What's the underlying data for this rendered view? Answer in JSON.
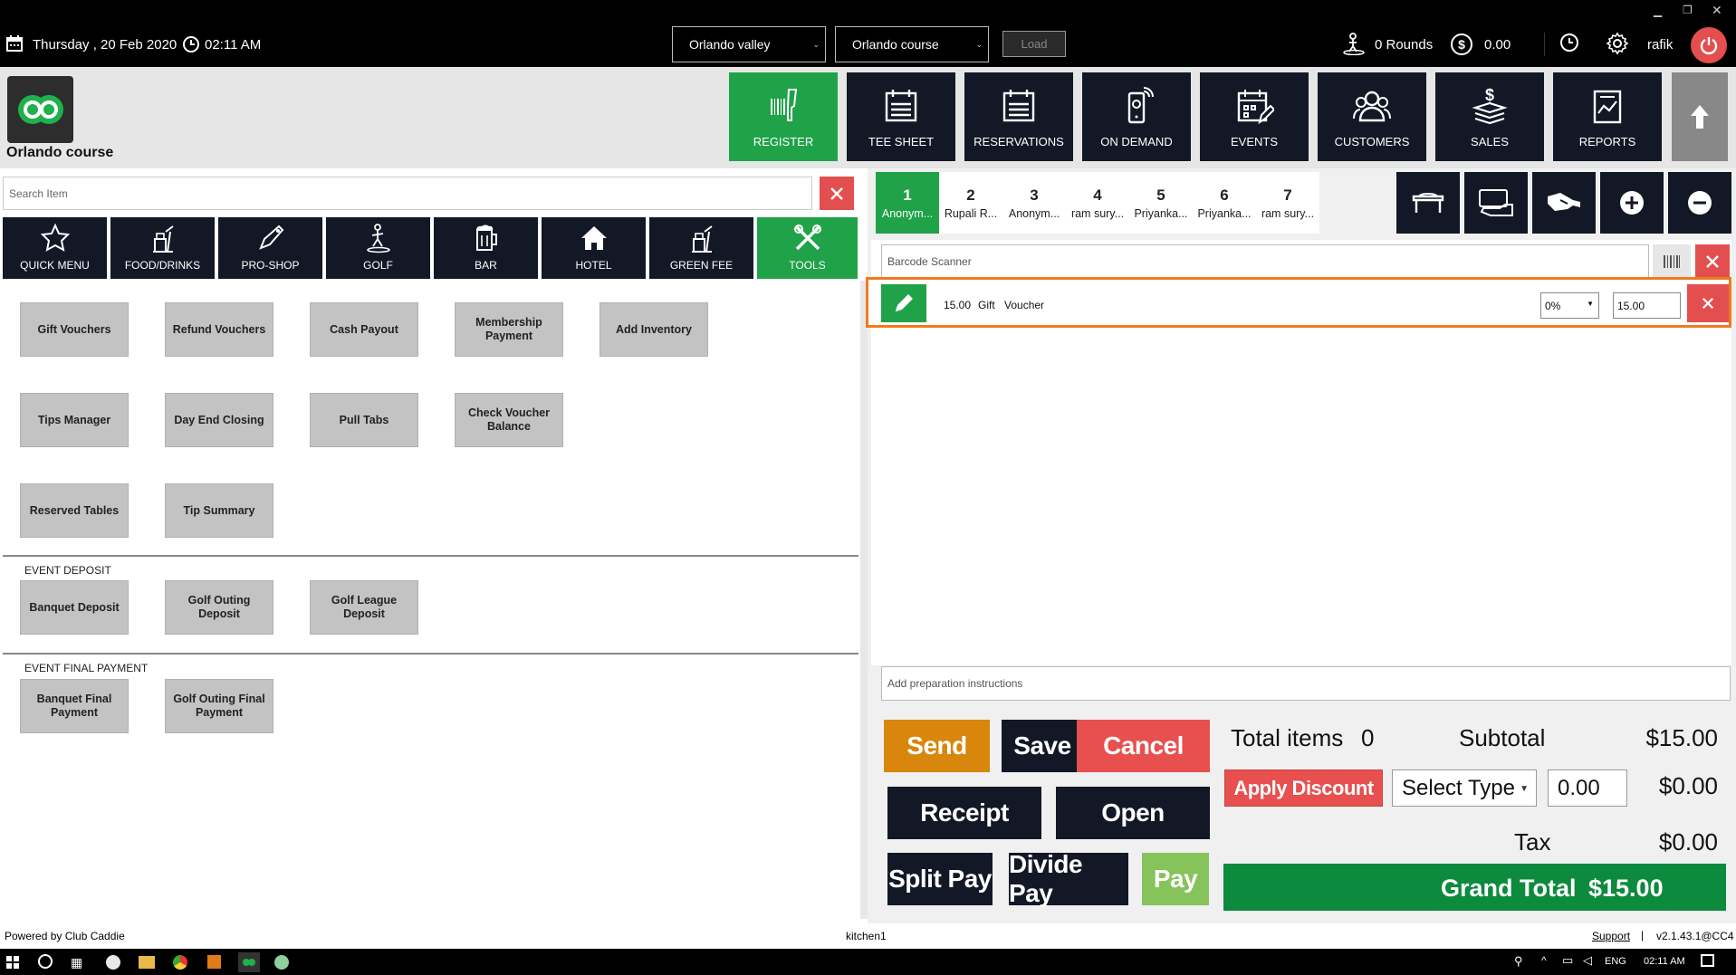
{
  "colors": {
    "accent_green": "#20a249",
    "nav_dark": "#121826",
    "danger_red": "#e34f4f",
    "send_orange": "#d8860c",
    "pay_green": "#86c35a",
    "highlight_orange": "#f07a1e"
  },
  "topbar": {
    "date": "Thursday , 20 Feb 2020",
    "time": "02:11 AM",
    "course_select_1": "Orlando valley",
    "course_select_2": "Orlando course",
    "load_label": "Load",
    "rounds": "0 Rounds",
    "amount": "0.00",
    "user": "rafik"
  },
  "brand": {
    "course_name": "Orlando course"
  },
  "nav": [
    {
      "label": "REGISTER",
      "icon": "barcode-scanner-icon"
    },
    {
      "label": "TEE SHEET",
      "icon": "calendar-list-icon"
    },
    {
      "label": "RESERVATIONS",
      "icon": "calendar-list-icon"
    },
    {
      "label": "ON DEMAND",
      "icon": "mobile-phone-icon"
    },
    {
      "label": "EVENTS",
      "icon": "calendar-edit-icon"
    },
    {
      "label": "CUSTOMERS",
      "icon": "users-icon"
    },
    {
      "label": "SALES",
      "icon": "dollar-stack-icon"
    },
    {
      "label": "REPORTS",
      "icon": "chart-report-icon"
    }
  ],
  "search": {
    "placeholder": "Search Item"
  },
  "categories": [
    "QUICK MENU",
    "FOOD/DRINKS",
    "PRO-SHOP",
    "GOLF",
    "BAR",
    "HOTEL",
    "GREEN FEE",
    "TOOLS"
  ],
  "tools": {
    "row1": [
      "Gift Vouchers",
      "Refund Vouchers",
      "Cash Payout",
      "Membership Payment",
      "Add Inventory"
    ],
    "row2": [
      "Tips Manager",
      "Day End Closing",
      "Pull Tabs",
      "Check Voucher Balance"
    ],
    "row3": [
      "Reserved Tables",
      "Tip Summary"
    ],
    "event_deposit_label": "EVENT DEPOSIT",
    "event_deposit": [
      "Banquet Deposit",
      "Golf Outing Deposit",
      "Golf League Deposit"
    ],
    "event_final_label": "EVENT FINAL PAYMENT",
    "event_final": [
      "Banquet Final Payment",
      "Golf Outing Final Payment"
    ]
  },
  "order_tabs": [
    {
      "num": "1",
      "name": "Anonym..."
    },
    {
      "num": "2",
      "name": "Rupali R..."
    },
    {
      "num": "3",
      "name": "Anonym..."
    },
    {
      "num": "4",
      "name": "ram sury..."
    },
    {
      "num": "5",
      "name": "Priyanka..."
    },
    {
      "num": "6",
      "name": "Priyanka..."
    },
    {
      "num": "7",
      "name": "ram sury..."
    }
  ],
  "scanner": {
    "placeholder": "Barcode Scanner"
  },
  "line_item": {
    "price": "15.00",
    "name1": "Gift",
    "name2": "Voucher",
    "discount": "0%",
    "amount": "15.00"
  },
  "prep": {
    "placeholder": "Add preparation instructions"
  },
  "actions": {
    "send": "Send",
    "save": "Save",
    "cancel": "Cancel",
    "receipt": "Receipt",
    "open": "Open",
    "split_pay": "Split Pay",
    "divide_pay": "Divide Pay",
    "pay": "Pay"
  },
  "totals": {
    "total_items_label": "Total items",
    "total_items": "0",
    "subtotal_label": "Subtotal",
    "subtotal": "$15.00",
    "apply_discount": "Apply Discount",
    "select_type": "Select Type",
    "discount_value": "0.00",
    "discount_amount": "$0.00",
    "tax_label": "Tax",
    "tax": "$0.00",
    "grand_total_label": "Grand Total",
    "grand_total": "$15.00"
  },
  "footer": {
    "powered": "Powered by Club Caddie",
    "station": "kitchen1",
    "support": "Support",
    "version": "v2.1.43.1@CC4"
  },
  "taskbar": {
    "lang": "ENG",
    "time": "02:11 AM"
  }
}
